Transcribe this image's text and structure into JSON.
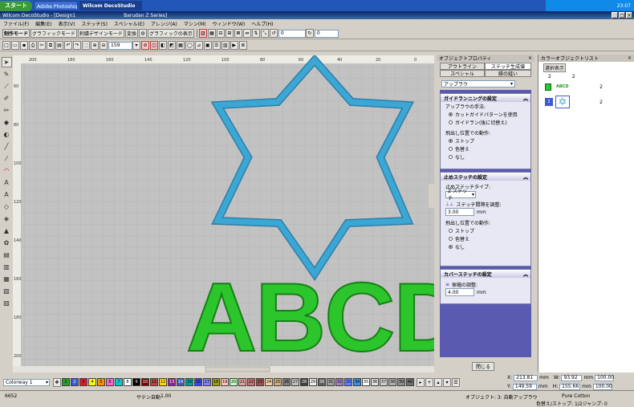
{
  "taskbar": {
    "start": "スタート",
    "tasks": [
      "Adobe Photoshop (応答...",
      "Wilcom DecoStudio"
    ],
    "time": "23:07"
  },
  "window": {
    "title": "Wilcom DecoStudio - [Design1",
    "model": "Barudan Z Series]"
  },
  "menu": [
    "ファイル(F)",
    "編集(E)",
    "表示(V)",
    "ステッチ(S)",
    "スペシャル(E)",
    "アレンジ(A)",
    "マシン(M)",
    "ウィンドウ(W)",
    "ヘルプ(H)"
  ],
  "toolbar1": {
    "mode": "制作モード",
    "graphic_mode": "グラフィックモード",
    "stitch_design_mode": "刺繍デザインモード",
    "convert": "変換",
    "graphic_display": "グラフィックの表示",
    "angle1": "0",
    "angle2": "0"
  },
  "toolbar2": {
    "zoom": "159"
  },
  "ruler": {
    "top": [
      "200",
      "180",
      "160",
      "140",
      "120",
      "100",
      "80",
      "60",
      "40",
      "20",
      "0"
    ],
    "left": [
      "60",
      "80",
      "100",
      "120",
      "140",
      "160",
      "180",
      "200"
    ]
  },
  "canvas": {
    "text": "ABCD",
    "colors": {
      "star": "#3ba7d4",
      "letters": "#2cc52c",
      "grid": "#b2b2b2",
      "bg": "#c2c2c2"
    }
  },
  "obj_props": {
    "title": "オブジェクトプロパティ",
    "tabs": [
      "アウトライン",
      "ステッチ生成値",
      "スペシャル",
      "縁の縫い"
    ],
    "dropdown": "アップラウ",
    "sec1": {
      "title": "ガイドランニングの設定",
      "method_label": "アップラウの手法:",
      "opt1": "カットガイドパターンを使用",
      "opt2": "ガイドラン(後に切替え)",
      "action_label": "飛出し位置での動作:",
      "a1": "ストップ",
      "a2": "色替え",
      "a3": "なし"
    },
    "sec2": {
      "title": "止めステッチの設定",
      "type_label": "止めステッチタイプ:",
      "type_value": "Z ステッチ",
      "spacing_label": "ステッチ間隔を調整:",
      "spacing_value": "3.00",
      "unit": "mm",
      "action_label": "飛出し位置での動作:",
      "a1": "ストップ",
      "a2": "色替え",
      "a3": "なし"
    },
    "sec3": {
      "title": "カバーステッチの設定",
      "width_label": "振幅の調整:",
      "width_value": "4.00",
      "unit": "mm"
    },
    "close": "閉じる"
  },
  "color_list": {
    "title": "カラーオブジェクトリスト",
    "button": "選択表示",
    "col1": "2",
    "col2": "2",
    "item1": "ABCD",
    "item2_no": "2"
  },
  "bottom": {
    "colorway": "Colorway 1",
    "swatches": [
      "1",
      "2",
      "3",
      "4",
      "5",
      "6",
      "7",
      "8",
      "9",
      "10",
      "11",
      "12",
      "13",
      "14",
      "15",
      "16",
      "17",
      "18",
      "19",
      "20",
      "21",
      "22",
      "23",
      "24",
      "25",
      "26",
      "27",
      "28",
      "29",
      "30",
      "31",
      "32",
      "33",
      "34",
      "35",
      "36",
      "37",
      "38",
      "39",
      "40"
    ],
    "x_label": "X:",
    "x": "213.81",
    "w_label": "W:",
    "w": "93.92",
    "mm": "mm",
    "mm2": "100.00",
    "y_label": "Y:",
    "y": "149.59",
    "h_label": "H:",
    "h": "155.66",
    "mm3": "100.00"
  },
  "status": {
    "left": "6652",
    "mid": "サテン自動",
    "val": "1.00",
    "obj": "オブジェクト: 3: 自動アップラウ",
    "thread": "Pure Cotton",
    "count": "色替え/ストップ: 1/2ジャンプ: 0"
  }
}
